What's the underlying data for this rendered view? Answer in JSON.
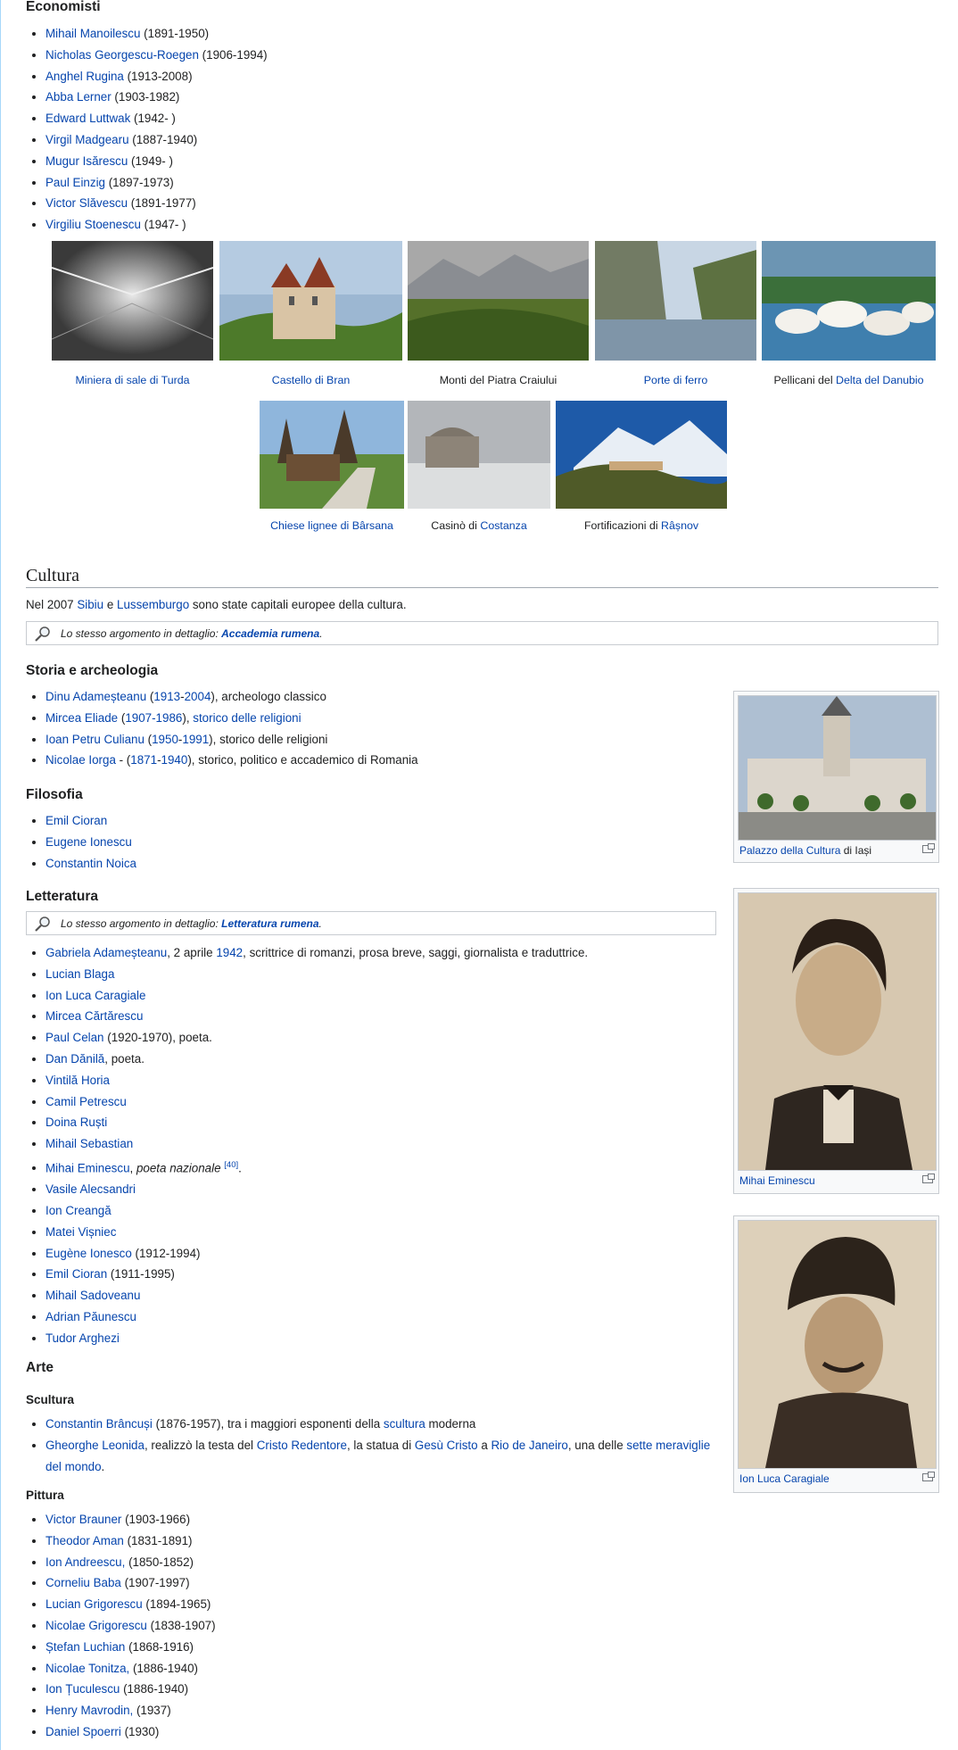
{
  "economisti": {
    "heading": "Economisti",
    "items": [
      {
        "name": "Mihail Manoilescu",
        "years": " (1891-1950)",
        "red": false
      },
      {
        "name": "Nicholas Georgescu-Roegen",
        "years": " (1906-1994)",
        "red": false
      },
      {
        "name": "Anghel Rugina",
        "years": " (1913-2008)",
        "red": true
      },
      {
        "name": "Abba Lerner",
        "years": " (1903-1982)",
        "red": false
      },
      {
        "name": "Edward Luttwak",
        "years": " (1942- )",
        "red": false
      },
      {
        "name": "Virgil Madgearu",
        "years": " (1887-1940)",
        "red": true
      },
      {
        "name": "Mugur Isărescu",
        "years": " (1949- )",
        "red": false
      },
      {
        "name": "Paul Einzig",
        "years": " (1897-1973)",
        "red": true
      },
      {
        "name": "Victor Slăvescu",
        "years": " (1891-1977)",
        "red": true
      },
      {
        "name": "Virgiliu Stoenescu",
        "years": " (1947- )",
        "red": true
      }
    ]
  },
  "gallery": {
    "row1": [
      {
        "caption_pre": "",
        "caption_link": "Miniera di sale di Turda",
        "caption_post": ""
      },
      {
        "caption_pre": "",
        "caption_link": "Castello di Bran",
        "caption_post": ""
      },
      {
        "caption_pre": "Monti del Piatra Craiului",
        "caption_link": "",
        "caption_post": ""
      },
      {
        "caption_pre": "",
        "caption_link": "Porte di ferro",
        "caption_post": ""
      },
      {
        "caption_pre": "Pellicani del ",
        "caption_link": "Delta del Danubio",
        "caption_post": ""
      }
    ],
    "row2": [
      {
        "caption_pre": "",
        "caption_link": "Chiese lignee di Bârsana",
        "caption_post": ""
      },
      {
        "caption_pre": "Casinò di ",
        "caption_link": "Costanza",
        "caption_post": ""
      },
      {
        "caption_pre": "Fortificazioni di ",
        "caption_link": "Râșnov",
        "caption_post": ""
      }
    ]
  },
  "cultura": {
    "heading": "Cultura",
    "intro_pre": "Nel 2007 ",
    "intro_link1": "Sibiu",
    "intro_mid": " e ",
    "intro_link2": "Lussemburgo",
    "intro_post": " sono state capitali europee della cultura.",
    "hatnote_pre": "Lo stesso argomento in dettaglio: ",
    "hatnote_link": "Accademia rumena",
    "hatnote_post": "."
  },
  "storia": {
    "heading": "Storia e archeologia",
    "items": [
      {
        "name": "Dinu Adameșteanu",
        "a": " (",
        "y1": "1913",
        "dash": "-",
        "y2": "2004",
        "rest_link": "",
        "rest": "), archeologo classico"
      },
      {
        "name": "Mircea Eliade",
        "a": " (",
        "y1": "1907-1986",
        "dash": "",
        "y2": "",
        "rest_link": "storico delle religioni",
        "rest": "), "
      },
      {
        "name": "Ioan Petru Culianu",
        "a": " (",
        "y1": "1950",
        "dash": "-",
        "y2": "1991",
        "rest_link": "",
        "rest": "), storico delle religioni"
      },
      {
        "name": "Nicolae Iorga",
        "a": " - (",
        "y1": "1871",
        "dash": "-",
        "y2": "1940",
        "rest_link": "",
        "rest": "), storico, politico e accademico di Romania"
      }
    ]
  },
  "filosofia": {
    "heading": "Filosofia",
    "items": [
      "Emil Cioran",
      "Eugene Ionescu",
      "Constantin Noica"
    ]
  },
  "letteratura": {
    "heading": "Letteratura",
    "hatnote_pre": "Lo stesso argomento in dettaglio: ",
    "hatnote_link": "Letteratura rumena",
    "hatnote_post": ".",
    "first": {
      "name": "Gabriela Adameșteanu",
      "pre": ", 2 aprile ",
      "year": "1942",
      "post": ", scrittrice di romanzi, prosa breve, saggi, giornalista e traduttrice."
    },
    "items": [
      {
        "name": "Lucian Blaga",
        "post": ""
      },
      {
        "name": "Ion Luca Caragiale",
        "post": ""
      },
      {
        "name": "Mircea Cărtărescu",
        "post": ""
      },
      {
        "name": "Paul Celan",
        "post": " (1920-1970), poeta."
      },
      {
        "name": "Dan Dănilă",
        "post": ", poeta."
      },
      {
        "name": "Vintilă Horia",
        "post": ""
      },
      {
        "name": "Camil Petrescu",
        "post": ""
      },
      {
        "name": "Doina Ruști",
        "post": ""
      },
      {
        "name": "Mihail Sebastian",
        "post": ""
      }
    ],
    "eminescu": {
      "name": "Mihai Eminescu",
      "pre": ", ",
      "italic": "poeta nazionale",
      "ref": "[40]",
      "post": "."
    },
    "items2": [
      {
        "name": "Vasile Alecsandri",
        "post": ""
      },
      {
        "name": "Ion Creangă",
        "post": ""
      },
      {
        "name": "Matei Vișniec",
        "post": ""
      },
      {
        "name": "Eugène Ionesco",
        "post": " (1912-1994)"
      },
      {
        "name": "Emil Cioran",
        "post": " (1911-1995)"
      },
      {
        "name": "Mihail Sadoveanu",
        "post": ""
      },
      {
        "name": "Adrian Păunescu",
        "post": ""
      },
      {
        "name": "Tudor Arghezi",
        "post": ""
      }
    ]
  },
  "arte": {
    "heading": "Arte",
    "scultura_heading": "Scultura",
    "brancusi": {
      "name": "Constantin Brâncuși",
      "pre": " (1876-1957), tra i maggiori esponenti della ",
      "link": "scultura",
      "post": " moderna"
    },
    "leonida": {
      "name": "Gheorghe Leonida",
      "t1": ", realizzò la testa del ",
      "l1": "Cristo Redentore",
      "t2": ", la statua di ",
      "l2": "Gesù Cristo",
      "t3": " a ",
      "l3": "Rio de Janeiro",
      "t4": ", una delle ",
      "l4a": "sette",
      "l4b": "meraviglie del mondo",
      "t5": "."
    },
    "pittura_heading": "Pittura",
    "pittura": [
      {
        "name": "Victor Brauner",
        "years": " (1903-1966)",
        "red": false
      },
      {
        "name": "Theodor Aman",
        "years": " (1831-1891)",
        "red": false
      },
      {
        "name": "Ion Andreescu,",
        "years": " (1850-1852)",
        "red": false
      },
      {
        "name": "Corneliu Baba",
        "years": " (1907-1997)",
        "red": false
      },
      {
        "name": "Lucian Grigorescu",
        "years": " (1894-1965)",
        "red": true
      },
      {
        "name": "Nicolae Grigorescu",
        "years": " (1838-1907)",
        "red": false
      },
      {
        "name": "Ștefan Luchian",
        "years": " (1868-1916)",
        "red": false
      },
      {
        "name": "Nicolae Tonitza,",
        "years": " (1886-1940)",
        "red": false
      },
      {
        "name": "Ion Țuculescu",
        "years": " (1886-1940)",
        "red": false
      },
      {
        "name": "Henry Mavrodin,",
        "years": " (1937)",
        "red": false
      },
      {
        "name": "Daniel Spoerri",
        "years": " (1930)",
        "red": false
      }
    ]
  },
  "thumbs": {
    "palazzo": {
      "link": "Palazzo della Cultura",
      "post": " di Iași"
    },
    "eminescu": {
      "link": "Mihai Eminescu",
      "post": ""
    },
    "caragiale": {
      "link": "Ion Luca Caragiale",
      "post": ""
    }
  },
  "colors": {
    "link": "#0645ad",
    "redlink": "#ba0000",
    "border": "#c8ccd1",
    "thumb_bg": "#f8f9fa"
  }
}
